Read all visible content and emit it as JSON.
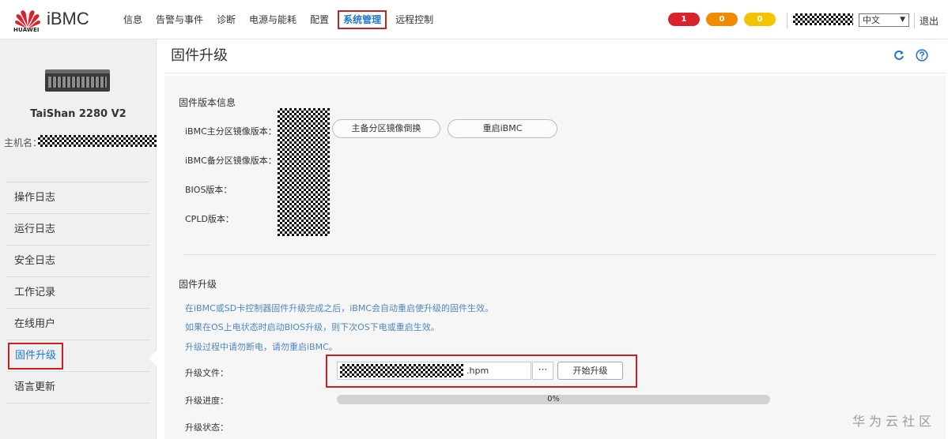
{
  "header": {
    "logo_text": "HUAWEI",
    "brand": "iBMC",
    "nav": [
      "信息",
      "告警与事件",
      "诊断",
      "电源与能耗",
      "配置",
      "系统管理",
      "远程控制"
    ],
    "alerts": {
      "critical": "1",
      "major": "0",
      "minor": "0"
    },
    "language": "中文",
    "logout": "退出"
  },
  "sidebar": {
    "model": "TaiShan 2280 V2",
    "hostname_label": "主机名：",
    "items": [
      "操作日志",
      "运行日志",
      "安全日志",
      "工作记录",
      "在线用户",
      "固件升级",
      "语言更新"
    ]
  },
  "main": {
    "title": "固件升级",
    "version_section": {
      "title": "固件版本信息",
      "primary_label": "iBMC主分区镜像版本：",
      "backup_label": "iBMC备分区镜像版本：",
      "bios_label": "BIOS版本：",
      "cpld_label": "CPLD版本：",
      "switch_button": "主备分区镜像倒换",
      "restart_button": "重启iBMC"
    },
    "upgrade_section": {
      "title": "固件升级",
      "notes": [
        "在iBMC或SD卡控制器固件升级完成之后，iBMC会自动重启使升级的固件生效。",
        "如果在OS上电状态时启动BIOS升级，则下次OS下电或重启生效。",
        "升级过程中请勿断电，请勿重启iBMC。"
      ],
      "file_label": "升级文件：",
      "file_suffix": ".hpm",
      "browse_button": "···",
      "start_button": "开始升级",
      "progress_label": "升级进度：",
      "progress_value": 0,
      "progress_text": "0%",
      "status_label": "升级状态："
    }
  },
  "watermark": "华为云社区",
  "colors": {
    "accent": "#1e78d2",
    "highlight": "#cc1f1f",
    "critical": "#d9222a",
    "major": "#f08a00",
    "minor": "#f5c400",
    "note": "#4f87c0"
  }
}
